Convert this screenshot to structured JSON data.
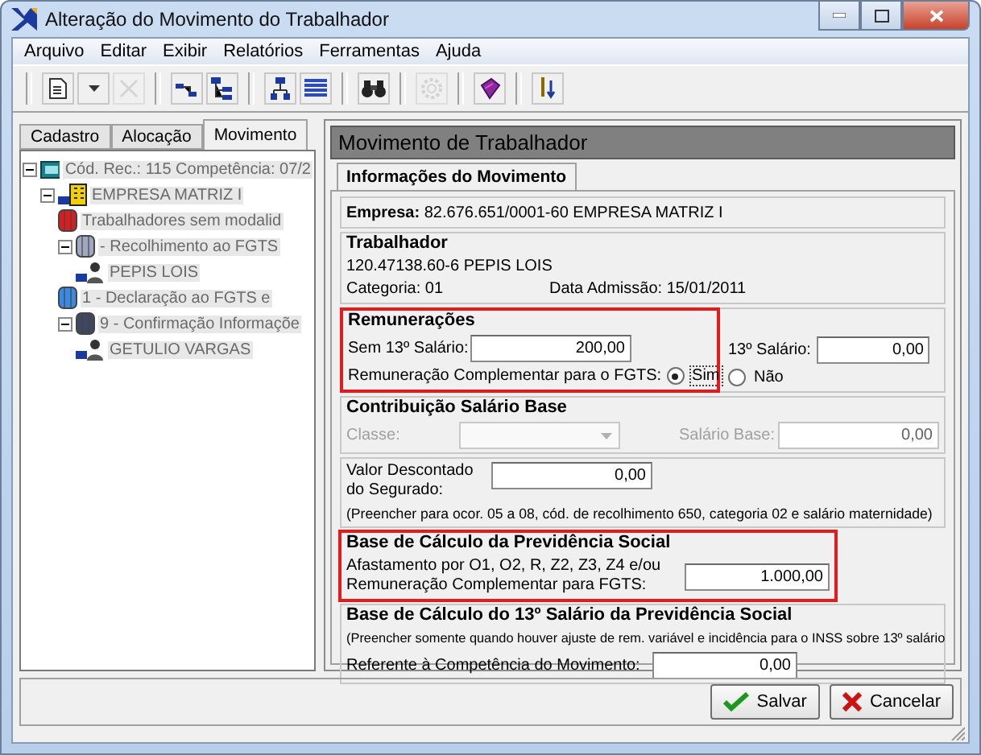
{
  "window": {
    "title": "Alteração do Movimento do Trabalhador"
  },
  "menu": [
    "Arquivo",
    "Editar",
    "Exibir",
    "Relatórios",
    "Ferramentas",
    "Ajuda"
  ],
  "toolbar": [
    {
      "buttons": [
        {
          "kind": "document",
          "disabled": false
        },
        {
          "kind": "caret",
          "disabled": false
        },
        {
          "kind": "delete",
          "disabled": true
        }
      ]
    },
    {
      "buttons": [
        {
          "kind": "tree-small",
          "disabled": false
        },
        {
          "kind": "tree-large",
          "disabled": false
        }
      ]
    },
    {
      "buttons": [
        {
          "kind": "hierarchy",
          "disabled": false
        },
        {
          "kind": "list",
          "disabled": false
        }
      ]
    },
    {
      "buttons": [
        {
          "kind": "binoculars",
          "disabled": false
        }
      ]
    },
    {
      "buttons": [
        {
          "kind": "gear",
          "disabled": true
        }
      ]
    },
    {
      "buttons": [
        {
          "kind": "book",
          "disabled": false
        }
      ]
    },
    {
      "buttons": [
        {
          "kind": "sort",
          "disabled": false
        }
      ]
    }
  ],
  "side_tabs": [
    {
      "label": "Cadastro",
      "selected": false
    },
    {
      "label": "Alocação",
      "selected": false
    },
    {
      "label": "Movimento",
      "selected": true
    }
  ],
  "tree": [
    {
      "label": "Cód. Rec.: 115 Competência: 07/2",
      "kind": "computer",
      "expanded": true,
      "children": [
        {
          "label": "EMPRESA MATRIZ I",
          "kind": "building",
          "expanded": true,
          "children": [
            {
              "label": "Trabalhadores sem modalid",
              "kind": "red-group"
            },
            {
              "label": "- Recolhimento ao FGTS",
              "kind": "gray-group",
              "expanded": true,
              "children": [
                {
                  "label": "PEPIS LOIS",
                  "kind": "person"
                }
              ]
            },
            {
              "label": "1 - Declaração ao FGTS e",
              "kind": "blue-group"
            },
            {
              "label": "9 - Confirmação Informaçõe",
              "kind": "dark-group",
              "expanded": true,
              "children": [
                {
                  "label": "GETULIO VARGAS",
                  "kind": "person"
                }
              ]
            }
          ]
        }
      ]
    }
  ],
  "panel": {
    "title": "Movimento de Trabalhador",
    "tab": {
      "label": "Informações do Movimento",
      "selected": true
    }
  },
  "empresa": {
    "label": "Empresa:",
    "value": "82.676.651/0001-60  EMPRESA MATRIZ I"
  },
  "trabalhador": {
    "title": "Trabalhador",
    "id": "120.47138.60-6  PEPIS LOIS",
    "categoria": "Categoria: 01",
    "admissao": "Data Admissão: 15/01/2011"
  },
  "remuneracoes": {
    "title": "Remunerações",
    "highlighted": true,
    "sem13": {
      "label": "Sem 13º Salário:",
      "value": "200,00"
    },
    "com13": {
      "label": "13º Salário:",
      "value": "0,00"
    },
    "complementar": {
      "label": "Remuneração Complementar para o FGTS:",
      "options": [
        {
          "label": "Sim",
          "selected": true
        },
        {
          "label": "Não",
          "selected": false
        }
      ]
    }
  },
  "contribuicao": {
    "title": "Contribuição Salário Base",
    "classe": {
      "label": "Classe:",
      "disabled": true
    },
    "salario_base": {
      "label": "Salário Base:",
      "value": "0,00",
      "disabled": true
    }
  },
  "desconto": {
    "label": "Valor Descontado do Segurado:",
    "value": "0,00",
    "note": "(Preencher para ocor. 05 a 08, cód. de recolhimento 650, categoria 02 e salário maternidade)"
  },
  "base_calculo": {
    "title": "Base de Cálculo da Previdência Social",
    "highlighted": true,
    "label": "Afastamento por O1, O2, R, Z2, Z3, Z4 e/ou Remuneração Complementar para FGTS:",
    "value": "1.000,00"
  },
  "base_13": {
    "title": "Base de Cálculo do 13º Salário da Previdência Social",
    "note": "(Preencher somente quando houver ajuste de rem. variável e incidência para o INSS sobre 13º salário",
    "field": {
      "label": "Referente à Competência do Movimento:",
      "value": "0,00"
    }
  },
  "buttons": [
    {
      "label": "Salvar",
      "kind": "save"
    },
    {
      "label": "Cancelar",
      "kind": "cancel"
    }
  ]
}
